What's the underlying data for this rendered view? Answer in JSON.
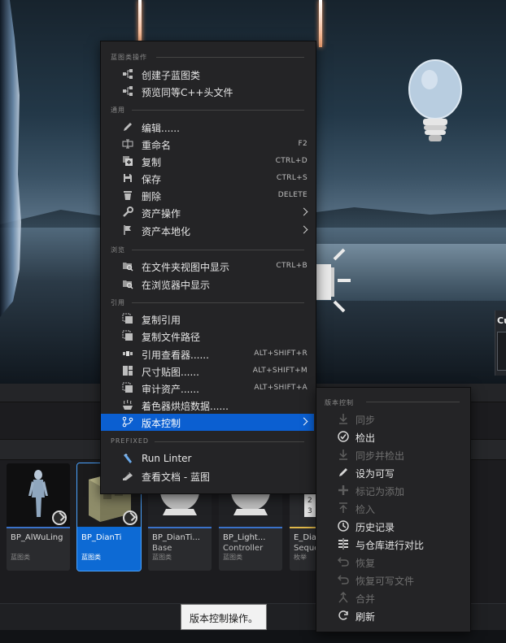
{
  "viewport": {
    "side_panel_label": "Cu"
  },
  "context_menu": {
    "sections": [
      {
        "header": "蓝图类操作",
        "items": [
          {
            "label": "创建子蓝图类",
            "icon": "blueprint-class-icon",
            "shortcut": ""
          },
          {
            "label": "预览同等C++头文件",
            "icon": "cpp-header-icon",
            "shortcut": ""
          }
        ]
      },
      {
        "header": "通用",
        "items": [
          {
            "label": "编辑......",
            "icon": "pencil-icon",
            "shortcut": ""
          },
          {
            "label": "重命名",
            "icon": "rename-icon",
            "shortcut": "F2"
          },
          {
            "label": "复制",
            "icon": "duplicate-icon",
            "shortcut": "CTRL+D"
          },
          {
            "label": "保存",
            "icon": "save-icon",
            "shortcut": "CTRL+S"
          },
          {
            "label": "删除",
            "icon": "trash-icon",
            "shortcut": "DELETE"
          },
          {
            "label": "资产操作",
            "icon": "wrench-icon",
            "shortcut": "",
            "submenu": true
          },
          {
            "label": "资产本地化",
            "icon": "flag-icon",
            "shortcut": "",
            "submenu": true
          }
        ]
      },
      {
        "header": "浏览",
        "items": [
          {
            "label": "在文件夹视图中显示",
            "icon": "folder-search-icon",
            "shortcut": "CTRL+B"
          },
          {
            "label": "在浏览器中显示",
            "icon": "folder-search-icon",
            "shortcut": ""
          }
        ]
      },
      {
        "header": "引用",
        "items": [
          {
            "label": "复制引用",
            "icon": "copy-reference-icon",
            "shortcut": ""
          },
          {
            "label": "复制文件路径",
            "icon": "copy-path-icon",
            "shortcut": ""
          },
          {
            "label": "引用查看器......",
            "icon": "reference-viewer-icon",
            "shortcut": "ALT+SHIFT+R"
          },
          {
            "label": "尺寸贴图......",
            "icon": "size-map-icon",
            "shortcut": "ALT+SHIFT+M"
          },
          {
            "label": "审计资产......",
            "icon": "audit-icon",
            "shortcut": "ALT+SHIFT+A"
          },
          {
            "label": "着色器烘焙数据......",
            "icon": "shader-cook-icon",
            "shortcut": ""
          },
          {
            "label": "版本控制",
            "icon": "source-control-icon",
            "shortcut": "",
            "submenu": true,
            "highlighted": true
          }
        ]
      },
      {
        "header": "PREFIXED",
        "items": [
          {
            "label": "Run Linter",
            "icon": "linter-icon",
            "shortcut": ""
          },
          {
            "label": "查看文档 - 蓝图",
            "icon": "documentation-icon",
            "shortcut": ""
          }
        ]
      }
    ]
  },
  "source_control_submenu": {
    "header": "版本控制",
    "items": [
      {
        "label": "同步",
        "icon": "sync-down-icon",
        "enabled": false
      },
      {
        "label": "检出",
        "icon": "check-circle-icon",
        "enabled": true
      },
      {
        "label": "同步并检出",
        "icon": "sync-checkout-icon",
        "enabled": false
      },
      {
        "label": "设为可写",
        "icon": "pencil-icon",
        "enabled": true
      },
      {
        "label": "标记为添加",
        "icon": "plus-icon",
        "enabled": false
      },
      {
        "label": "检入",
        "icon": "check-in-icon",
        "enabled": false
      },
      {
        "label": "历史记录",
        "icon": "history-icon",
        "enabled": true
      },
      {
        "label": "与仓库进行对比",
        "icon": "diff-icon",
        "enabled": true
      },
      {
        "label": "恢复",
        "icon": "revert-icon",
        "enabled": false
      },
      {
        "label": "恢复可写文件",
        "icon": "revert-icon",
        "enabled": false
      },
      {
        "label": "合并",
        "icon": "merge-icon",
        "enabled": false
      },
      {
        "label": "刷新",
        "icon": "refresh-icon",
        "enabled": true
      }
    ]
  },
  "asset_tiles": [
    {
      "name": "BP_AlWuLing",
      "name2": "",
      "type": "蓝图类",
      "selected": false
    },
    {
      "name": "BP_DianTi",
      "name2": "",
      "type": "蓝图类",
      "selected": true
    },
    {
      "name": "BP_DianTi...",
      "name2": "Base",
      "type": "蓝图类",
      "selected": false
    },
    {
      "name": "BP_Light...",
      "name2": "Controller",
      "type": "蓝图类",
      "selected": false
    },
    {
      "name": "E_Dia",
      "name2": "Seque",
      "type": "枚举",
      "selected": false
    }
  ],
  "tooltip": {
    "text": "版本控制操作。"
  },
  "colors": {
    "highlight": "#0b5fd1",
    "selected_tile": "#0d6ad4",
    "menu_bg": "#242426"
  }
}
